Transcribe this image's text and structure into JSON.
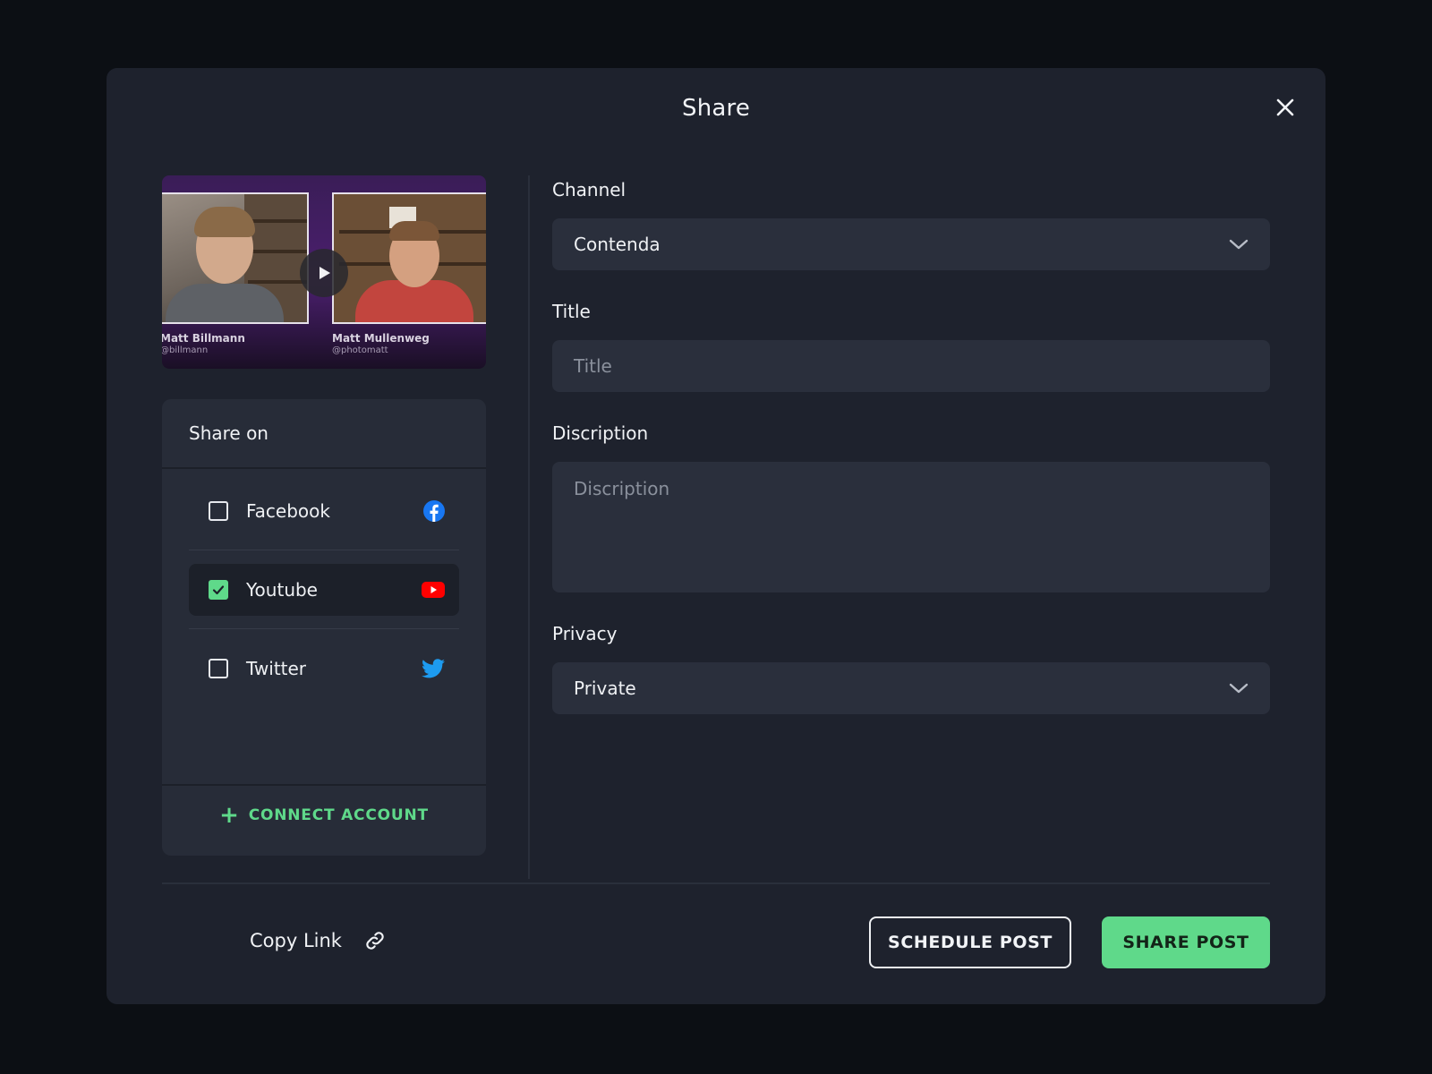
{
  "modal": {
    "title": "Share"
  },
  "preview": {
    "left_name": "Matt Billmann",
    "left_handle": "@billmann",
    "right_name": "Matt Mullenweg",
    "right_handle": "@photomatt"
  },
  "share_on": {
    "title": "Share on",
    "items": [
      {
        "label": "Facebook",
        "checked": false,
        "icon": "facebook-icon",
        "color": "#1877f2"
      },
      {
        "label": "Youtube",
        "checked": true,
        "icon": "youtube-icon",
        "color": "#ff0000"
      },
      {
        "label": "Twitter",
        "checked": false,
        "icon": "twitter-icon",
        "color": "#1d9bf0"
      }
    ],
    "connect_label": "CONNECT ACCOUNT"
  },
  "form": {
    "channel_label": "Channel",
    "channel_value": "Contenda",
    "title_label": "Title",
    "title_placeholder": "Title",
    "description_label": "Discription",
    "description_placeholder": "Discription",
    "privacy_label": "Privacy",
    "privacy_value": "Private"
  },
  "footer": {
    "copy_link_label": "Copy Link",
    "schedule_label": "SCHEDULE POST",
    "share_label": "SHARE POST"
  },
  "colors": {
    "accent": "#5fd98a",
    "background": "#1e222d",
    "panel": "#272c38"
  }
}
